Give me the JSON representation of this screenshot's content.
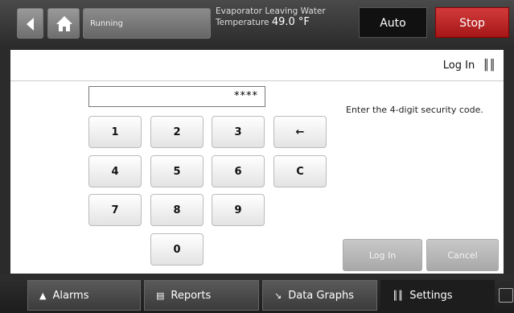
{
  "header": {
    "status": "Running",
    "evaporator_label": "Evaporator Leaving Water",
    "temperature_label": "Temperature",
    "temperature_value": "49.0 °F",
    "mode": "Auto",
    "stop": "Stop"
  },
  "login": {
    "title": "Log In",
    "code_value": "****",
    "hint": "Enter the 4-digit security code.",
    "keys": [
      "1",
      "2",
      "3",
      "←",
      "4",
      "5",
      "6",
      "C",
      "7",
      "8",
      "9",
      "0"
    ],
    "login_button": "Log In",
    "cancel_button": "Cancel"
  },
  "bottom_nav": [
    {
      "label": "Alarms",
      "icon": "alarm-icon"
    },
    {
      "label": "Reports",
      "icon": "reports-icon"
    },
    {
      "label": "Data Graphs",
      "icon": "graph-icon"
    },
    {
      "label": "Settings",
      "icon": "settings-icon"
    }
  ]
}
